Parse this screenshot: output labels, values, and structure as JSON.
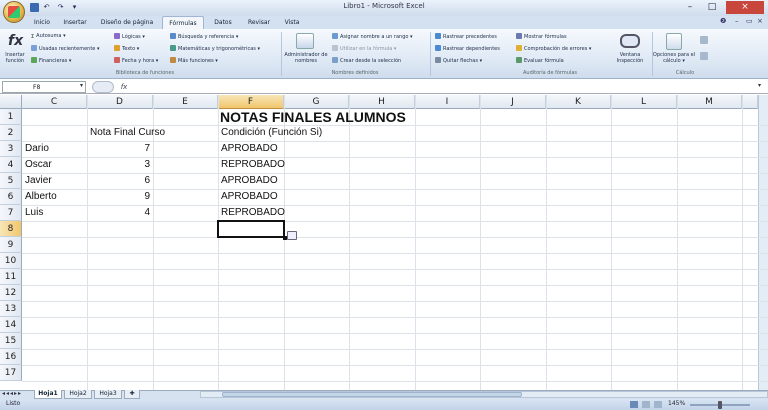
{
  "window": {
    "title": "Libro1 - Microsoft Excel",
    "controls": [
      "–",
      "□",
      "×"
    ]
  },
  "tabs": [
    "Inicio",
    "Insertar",
    "Diseño de página",
    "Fórmulas",
    "Datos",
    "Revisar",
    "Vista"
  ],
  "ribbon": {
    "insert_function": "Insertar función",
    "library": {
      "autosuma": "Autosuma ▾",
      "usadas": "Usadas recientemente ▾",
      "financieras": "Financieras ▾",
      "logicas": "Lógicas ▾",
      "texto": "Texto ▾",
      "fecha": "Fecha y hora ▾",
      "busqueda": "Búsqueda y referencia ▾",
      "matematicas": "Matemáticas y trigonométricas ▾",
      "mas": "Más funciones ▾",
      "group_title": "Biblioteca de funciones"
    },
    "names": {
      "administrador": "Administrador de nombres",
      "asignar": "Asignar nombre a un rango ▾",
      "utilizar": "Utilizar en la fórmula ▾",
      "crear": "Crear desde la selección",
      "group_title": "Nombres definidos"
    },
    "audit": {
      "precedentes": "Rastrear precedentes",
      "dependientes": "Rastrear dependientes",
      "quitar": "Quitar flechas ▾",
      "mostrar": "Mostrar fórmulas",
      "comprobacion": "Comprobación de errores ▾",
      "evaluar": "Evaluar fórmula",
      "ventana": "Ventana Inspección",
      "group_title": "Auditoría de fórmulas"
    },
    "calc": {
      "opciones": "Opciones para el cálculo ▾",
      "group_title": "Cálculo"
    }
  },
  "formula_bar": {
    "name_box": "F8",
    "fx": "fx",
    "content": ""
  },
  "columns": [
    "C",
    "D",
    "E",
    "F",
    "G",
    "H",
    "I",
    "J",
    "K",
    "L",
    "M"
  ],
  "selected_column": "F",
  "rows": [
    "1",
    "2",
    "3",
    "4",
    "5",
    "6",
    "7",
    "8",
    "9",
    "10",
    "11",
    "12",
    "13",
    "14",
    "15",
    "16",
    "17"
  ],
  "selected_row": "8",
  "cells": {
    "title": "NOTAS FINALES ALUMNOS",
    "header_nota": "Nota Final Curso",
    "header_condicion": "Condición (Función Si)",
    "students": [
      {
        "name": "Dario",
        "grade": "7",
        "status": "APROBADO"
      },
      {
        "name": "Oscar",
        "grade": "3",
        "status": "REPROBADO"
      },
      {
        "name": "Javier",
        "grade": "6",
        "status": "APROBADO"
      },
      {
        "name": "Alberto",
        "grade": "9",
        "status": "APROBADO"
      },
      {
        "name": "Luis",
        "grade": "4",
        "status": "REPROBADO"
      }
    ]
  },
  "sheets": [
    "Hoja1",
    "Hoja2",
    "Hoja3"
  ],
  "active_sheet": "Hoja1",
  "status": {
    "mode": "Listo",
    "zoom": "145%"
  },
  "colors": {
    "selection_header": "#f1c66b",
    "ribbon_bg": "#dce7f4",
    "grid_line": "#dbe2ea"
  }
}
